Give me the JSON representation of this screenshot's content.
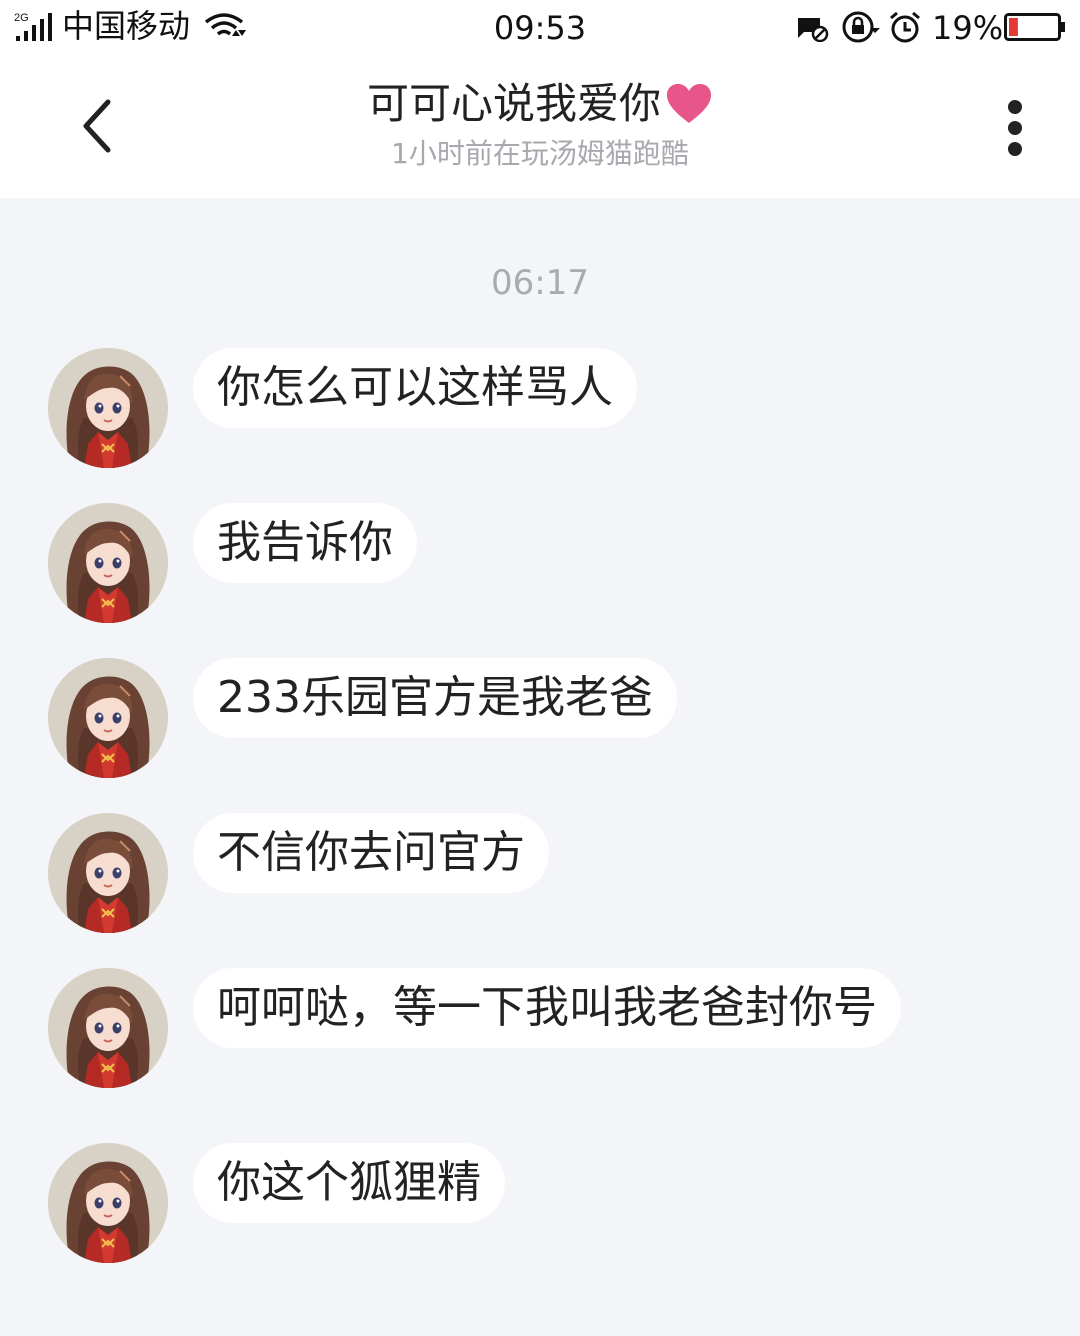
{
  "status_bar": {
    "network_type": "2G",
    "carrier": "中国移动",
    "time": "09:53",
    "battery_percent": "19%",
    "battery_level": 0.19,
    "icons": [
      "signal-icon",
      "wifi-icon",
      "message-blocked-icon",
      "rotation-lock-icon",
      "alarm-icon",
      "battery-icon"
    ]
  },
  "header": {
    "title": "可可心说我爱你",
    "title_decoration": "heart-icon",
    "subtitle": "1小时前在玩汤姆猫跑酷",
    "back_icon": "chevron-left-icon",
    "more_icon": "more-vertical-icon"
  },
  "chat": {
    "timestamp": "06:17",
    "messages": [
      {
        "sender": "other",
        "text": "你怎么可以这样骂人"
      },
      {
        "sender": "other",
        "text": "我告诉你"
      },
      {
        "sender": "other",
        "text": "233乐园官方是我老爸"
      },
      {
        "sender": "other",
        "text": "不信你去问官方"
      },
      {
        "sender": "other",
        "text": "呵呵哒，等一下我叫我老爸封你号"
      },
      {
        "sender": "other",
        "text": "你这个狐狸精"
      }
    ]
  },
  "colors": {
    "background": "#f4f5f9",
    "bubble": "#ffffff",
    "heart": "#e8558b",
    "battery_low": "#e53935",
    "subtitle": "#a8a8ae",
    "timestamp": "#a9abb2"
  }
}
